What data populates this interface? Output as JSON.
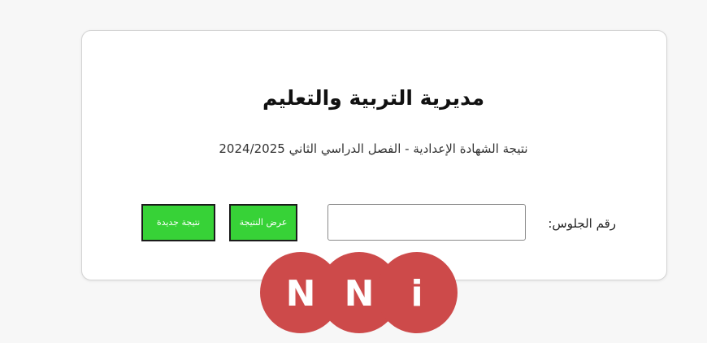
{
  "header": {
    "title": "مديرية التربية والتعليم",
    "subtitle": "نتيجة الشهادة الإعدادية - الفصل الدراسي الثاني 2024/2025"
  },
  "form": {
    "seat_label": "رقم الجلوس:",
    "seat_value": "",
    "show_result_label": "عرض النتيجة",
    "new_result_label": "نتيجة جديدة"
  },
  "logo": {
    "letters": [
      "N",
      "N",
      "i"
    ],
    "color": "#cd4a4a"
  },
  "colors": {
    "button_green": "#37d237",
    "card_background": "#ffffff",
    "page_background": "#f7f7f7"
  }
}
